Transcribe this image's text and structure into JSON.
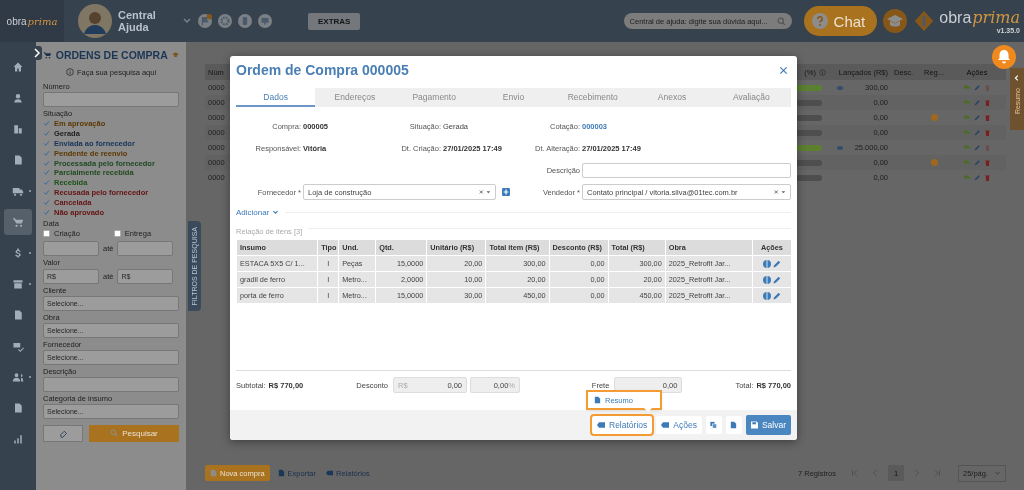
{
  "topbar": {
    "logo": {
      "word": "obra",
      "script": "prima"
    },
    "help_label": "Central Ajuda",
    "extras_button": "EXTRAS",
    "search": {
      "placeholder": "Central de ajuda: digite sua dúvida aqui..."
    },
    "chat_button": "Chat",
    "brand": {
      "word": "obra",
      "script": "prima"
    },
    "version": "v1.35.0"
  },
  "nav": {
    "items": [
      {
        "selected": false,
        "submenu": false
      },
      {
        "selected": false,
        "submenu": false
      },
      {
        "selected": false,
        "submenu": false
      },
      {
        "selected": false,
        "submenu": false
      },
      {
        "selected": false,
        "submenu": true
      },
      {
        "selected": true,
        "submenu": false
      },
      {
        "selected": false,
        "submenu": true
      },
      {
        "selected": false,
        "submenu": true
      },
      {
        "selected": false,
        "submenu": false
      },
      {
        "selected": false,
        "submenu": false
      },
      {
        "selected": false,
        "submenu": true
      },
      {
        "selected": false,
        "submenu": false
      },
      {
        "selected": false,
        "submenu": false
      }
    ]
  },
  "filters": {
    "title": "ORDENS DE COMPRA",
    "hint": "Faça sua pesquisa aqui",
    "number_label": "Número",
    "status_label": "Situação",
    "statuses": [
      {
        "label": "Em aprovação",
        "checked": true,
        "color": "#5c3800"
      },
      {
        "label": "Gerada",
        "checked": true,
        "color": "#1e1e1e"
      },
      {
        "label": "Enviada ao fornecedor",
        "checked": true,
        "color": "#15335a"
      },
      {
        "label": "Pendente de reenvio",
        "checked": true,
        "color": "#5c3800"
      },
      {
        "label": "Processada pelo fornecedor",
        "checked": true,
        "color": "#1d4a22"
      },
      {
        "label": "Parcialmente recebida",
        "checked": true,
        "color": "#1f4a1c"
      },
      {
        "label": "Recebida",
        "checked": true,
        "color": "#1c5218"
      },
      {
        "label": "Recusada pelo fornecedor",
        "checked": true,
        "color": "#651212"
      },
      {
        "label": "Cancelada",
        "checked": true,
        "color": "#651212"
      },
      {
        "label": "Não aprovado",
        "checked": true,
        "color": "#651212"
      }
    ],
    "date": {
      "label": "Data",
      "options": [
        {
          "label": "Criação",
          "checked": false
        },
        {
          "label": "Entrega",
          "checked": false
        }
      ],
      "separator": "até"
    },
    "value": {
      "label": "Valor",
      "from_placeholder": "R$",
      "separator": "até",
      "to_placeholder": "R$"
    },
    "selects": [
      {
        "label": "Cliente",
        "placeholder": "Selecione..."
      },
      {
        "label": "Obra",
        "placeholder": "Selecione..."
      },
      {
        "label": "Fornecedor",
        "placeholder": "Selecione..."
      },
      {
        "label": "Descrição"
      },
      {
        "label": "Categoria de insumo",
        "placeholder": "Selecione..."
      }
    ],
    "search_button": "Pesquisar",
    "side_tab": "FILTROS DE PESQUISA"
  },
  "list": {
    "number_header": "Núm",
    "columns": [
      "(%)",
      "Lançados (R$)",
      "Desc.",
      "Reg...",
      "Ações"
    ],
    "rows": [
      {
        "number": "0000",
        "level": 1,
        "launched": "300,00",
        "viewable": true,
        "flagged": false,
        "delete_disabled": true
      },
      {
        "number": "0000",
        "level": 0,
        "launched": "0,00",
        "viewable": false,
        "flagged": false,
        "delete_disabled": false
      },
      {
        "number": "0000",
        "level": 0,
        "launched": "0,00",
        "viewable": false,
        "flagged": true,
        "delete_disabled": false
      },
      {
        "number": "0000",
        "level": 0,
        "launched": "0,00",
        "viewable": false,
        "flagged": false,
        "delete_disabled": false
      },
      {
        "number": "0000",
        "level": 1,
        "launched": "25.000,00",
        "viewable": true,
        "flagged": false,
        "delete_disabled": true
      },
      {
        "number": "0000",
        "level": 0,
        "launched": "0,00",
        "viewable": false,
        "flagged": true,
        "delete_disabled": false
      },
      {
        "number": "0000",
        "level": 0,
        "launched": "0,00",
        "viewable": false,
        "flagged": false,
        "delete_disabled": false
      }
    ],
    "actions": [
      {
        "label": "Nova compra",
        "kind": "primary"
      },
      {
        "label": "Exportar",
        "kind": "export"
      },
      {
        "label": "Relatórios",
        "kind": "reports"
      }
    ],
    "pagination": {
      "count": "7 Registros",
      "page": "1",
      "page_size": "25/pág."
    },
    "side_tab": "Resumo"
  },
  "modal": {
    "title": "Ordem de Compra 000005",
    "tabs": [
      {
        "label": "Dados",
        "selected": true
      },
      {
        "label": "Endereços",
        "selected": false
      },
      {
        "label": "Pagamento",
        "selected": false
      },
      {
        "label": "Envio",
        "selected": false
      },
      {
        "label": "Recebimento",
        "selected": false
      },
      {
        "label": "Anexos",
        "selected": false
      },
      {
        "label": "Avaliação",
        "selected": false
      }
    ],
    "info": [
      {
        "label": "Compra:",
        "value": "000005",
        "kind": "bold"
      },
      {
        "label": "Situação:",
        "value": "Gerada",
        "kind": "plain"
      },
      {
        "label": "Cotação:",
        "value": "000003",
        "kind": "link"
      },
      {
        "label": "Responsável:",
        "value": "Vitória",
        "kind": "bold"
      },
      {
        "label": "Dt. Criação:",
        "value": "27/01/2025 17:49",
        "kind": "bold"
      },
      {
        "label": "Dt. Alteração:",
        "value": "27/01/2025 17:49",
        "kind": "bold"
      }
    ],
    "description": {
      "label": "Descrição"
    },
    "supplier": {
      "label": "Fornecedor *",
      "value": "Loja de construção"
    },
    "seller": {
      "label": "Vendedor *",
      "value": "Contato principal / vitoria.silva@01tec.com.br"
    },
    "add_link": "Adicionar",
    "items_title": "Relação de itens [3]",
    "items": {
      "columns": [
        "Insumo",
        "Tipo",
        "Und.",
        "Qtd.",
        "Unitário (R$)",
        "Total item (R$)",
        "Desconto (R$)",
        "Total (R$)",
        "Obra",
        "Ações"
      ],
      "rows": [
        [
          "ESTACA 5X5 C/ 1...",
          "I",
          "Peças",
          "15,0000",
          "20,00",
          "300,00",
          "0,00",
          "300,00",
          "2025_Retrofit Jar..."
        ],
        [
          "gradil de ferro",
          "I",
          "Metro...",
          "2,0000",
          "10,00",
          "20,00",
          "0,00",
          "20,00",
          "2025_Retrofit Jar..."
        ],
        [
          "porta de ferro",
          "I",
          "Metro...",
          "15,0000",
          "30,00",
          "450,00",
          "0,00",
          "450,00",
          "2025_Retrofit Jar..."
        ]
      ]
    },
    "totals": {
      "subtotal_label": "Subtotal:",
      "subtotal": "R$ 770,00",
      "discount_label": "Desconto",
      "discount_prefix": "R$",
      "discount_value": "0,00",
      "discount_percent": "0,00",
      "percent_sign": "%",
      "freight_label": "Frete",
      "freight_value": "0,00",
      "total_label": "Total:",
      "total": "R$ 770,00"
    },
    "footer_buttons": [
      {
        "label": "Relatórios",
        "kind": "menu",
        "highlighted": true
      },
      {
        "label": "Ações",
        "kind": "menu",
        "highlighted": false
      },
      {
        "kind": "copy",
        "highlighted": false
      },
      {
        "kind": "document",
        "highlighted": false
      },
      {
        "label": "Salvar",
        "kind": "primary",
        "highlighted": false
      }
    ],
    "menu": [
      {
        "label": "Resumo",
        "highlighted": true
      }
    ]
  }
}
